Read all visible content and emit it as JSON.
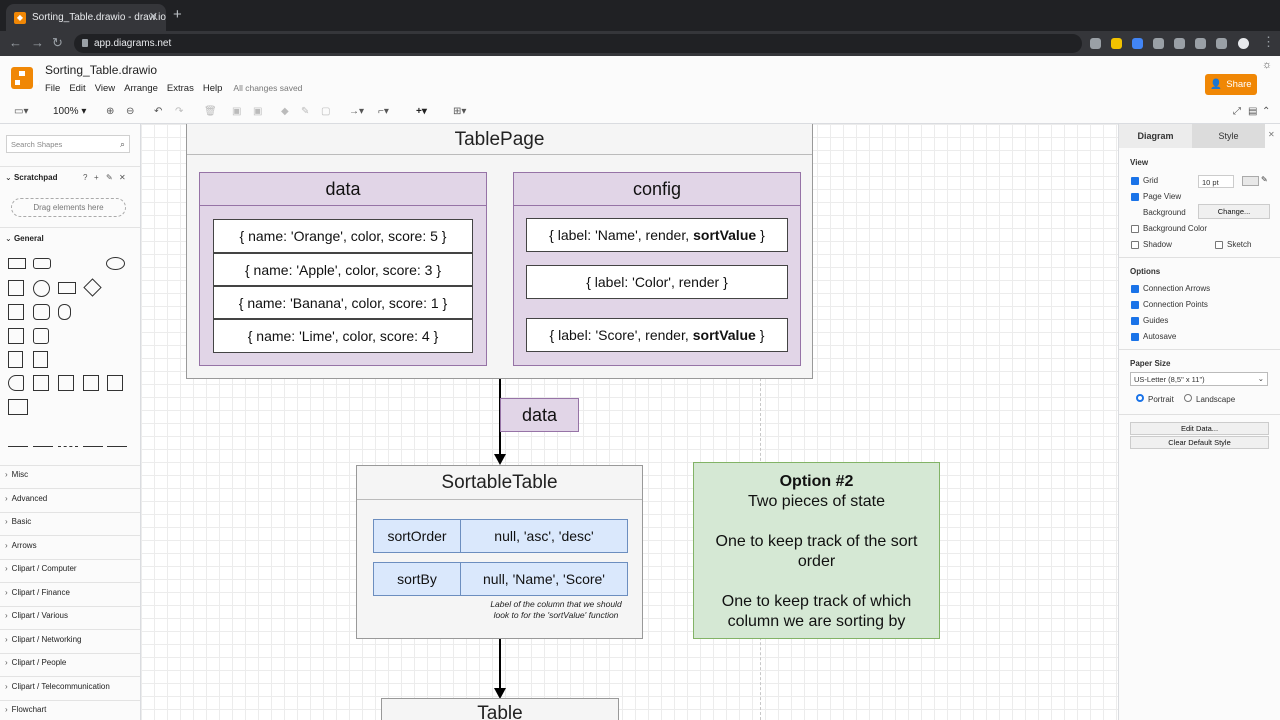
{
  "browser": {
    "tab_title": "Sorting_Table.drawio - draw.io",
    "url": "app.diagrams.net"
  },
  "app": {
    "file_name": "Sorting_Table.drawio",
    "menu": [
      "File",
      "Edit",
      "View",
      "Arrange",
      "Extras",
      "Help"
    ],
    "save_status": "All changes saved",
    "share_label": "Share"
  },
  "toolbar": {
    "zoom": "100%"
  },
  "left_panel": {
    "search_placeholder": "Search Shapes",
    "scratchpad_label": "Scratchpad",
    "drag_hint": "Drag elements here",
    "general_label": "General",
    "categories": [
      "Misc",
      "Advanced",
      "Basic",
      "Arrows",
      "Clipart / Computer",
      "Clipart / Finance",
      "Clipart / Various",
      "Clipart / Networking",
      "Clipart / People",
      "Clipart / Telecommunication",
      "Flowchart"
    ]
  },
  "diagram": {
    "table_page": {
      "title": "TablePage",
      "data_title": "data",
      "data_rows": [
        "{ name: 'Orange', color, score: 5 }",
        "{ name: 'Apple', color, score: 3 }",
        "{ name: 'Banana', color, score: 1 }",
        "{ name: 'Lime', color, score: 4 }"
      ],
      "config_title": "config",
      "config_rows": [
        {
          "pre": "{ label: 'Name', render,",
          "bold": "sortValue",
          "post": "}"
        },
        {
          "pre": "{ label: 'Color', render }",
          "bold": "",
          "post": ""
        },
        {
          "pre": "{ label: 'Score', render,",
          "bold": "sortValue",
          "post": "}"
        }
      ]
    },
    "edge_label": "data",
    "sortable_table": {
      "title": "SortableTable",
      "rows": [
        {
          "key": "sortOrder",
          "value": "null, 'asc', 'desc'"
        },
        {
          "key": "sortBy",
          "value": "null, 'Name', 'Score'"
        }
      ],
      "note": "Label of the column that we should look to for the 'sortValue' function"
    },
    "option_note": {
      "heading": "Option #2",
      "line1": "Two pieces of state",
      "line2": "One to keep track of the sort order",
      "line3": "One to keep track of which column we are sorting by"
    },
    "table_title": "Table"
  },
  "right_panel": {
    "tabs": [
      "Diagram",
      "Style"
    ],
    "view_label": "View",
    "grid_label": "Grid",
    "grid_size": "10 pt",
    "page_view_label": "Page View",
    "background_label": "Background",
    "change_label": "Change...",
    "background_color_label": "Background Color",
    "shadow_label": "Shadow",
    "sketch_label": "Sketch",
    "options_label": "Options",
    "connection_arrows_label": "Connection Arrows",
    "connection_points_label": "Connection Points",
    "guides_label": "Guides",
    "autosave_label": "Autosave",
    "paper_size_label": "Paper Size",
    "paper_size_value": "US-Letter (8,5\" x 11\")",
    "portrait_label": "Portrait",
    "landscape_label": "Landscape",
    "edit_data_label": "Edit Data...",
    "clear_style_label": "Clear Default Style"
  }
}
